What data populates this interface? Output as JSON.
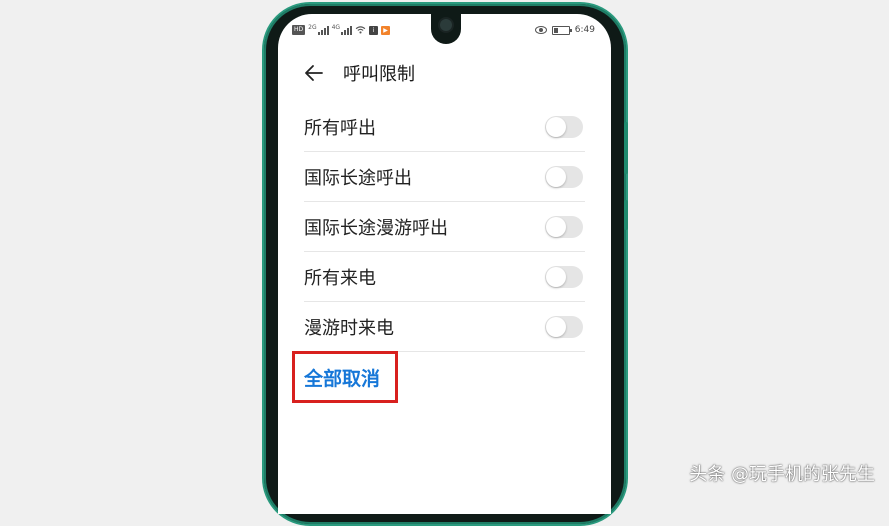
{
  "status_bar": {
    "left": {
      "hd": "HD",
      "net1": "2G",
      "net2": "4G",
      "app1": "i",
      "app2": "▶"
    },
    "time": "6:49",
    "battery_level": 0.3
  },
  "header": {
    "title": "呼叫限制"
  },
  "settings": [
    {
      "label": "所有呼出",
      "enabled": false
    },
    {
      "label": "国际长途呼出",
      "enabled": false
    },
    {
      "label": "国际长途漫游呼出",
      "enabled": false
    },
    {
      "label": "所有来电",
      "enabled": false
    },
    {
      "label": "漫游时来电",
      "enabled": false
    }
  ],
  "actions": {
    "cancel_all": "全部取消"
  },
  "annotation": {
    "highlight_color": "#d8201e"
  },
  "colors": {
    "accent": "#1677d8",
    "frame": "#2a9a7e"
  },
  "watermark": "头条 @玩手机的张先生"
}
